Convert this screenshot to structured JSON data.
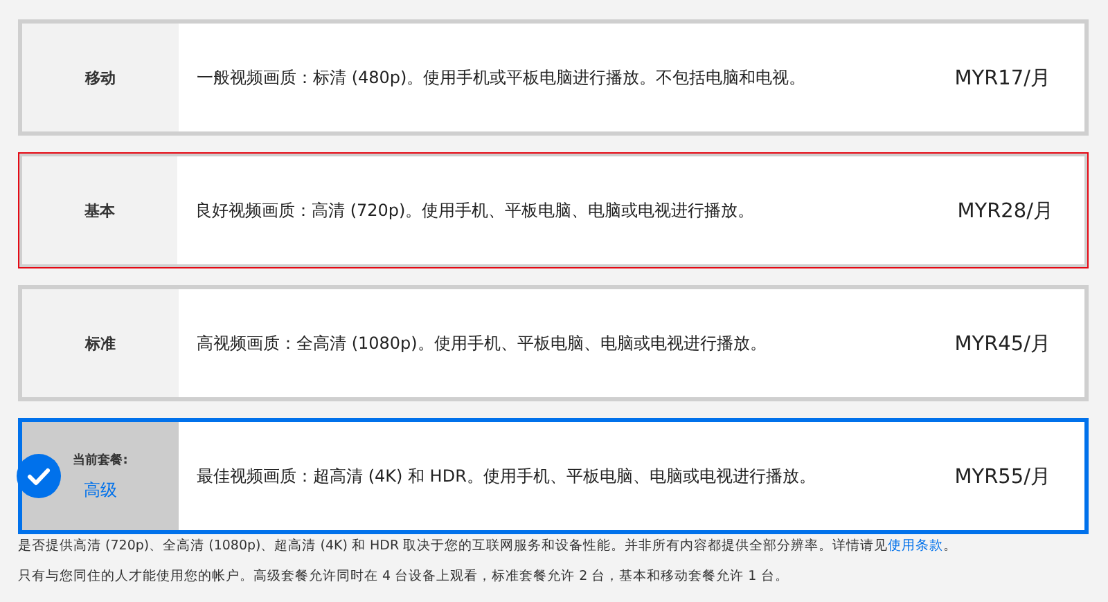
{
  "plans": [
    {
      "name": "移动",
      "description": "一般视频画质：标清 (480p)。使用手机或平板电脑进行播放。不包括电脑和电视。",
      "price": "MYR17/月",
      "selected": false,
      "focused": false
    },
    {
      "name": "基本",
      "description": "良好视频画质：高清 (720p)。使用手机、平板电脑、电脑或电视进行播放。",
      "price": "MYR28/月",
      "selected": false,
      "focused": true
    },
    {
      "name": "标准",
      "description": "高视频画质：全高清 (1080p)。使用手机、平板电脑、电脑或电视进行播放。",
      "price": "MYR45/月",
      "selected": false,
      "focused": false
    },
    {
      "current_label": "当前套餐:",
      "name": "高级",
      "description": "最佳视频画质：超高清 (4K) 和 HDR。使用手机、平板电脑、电脑或电视进行播放。",
      "price": "MYR55/月",
      "selected": true,
      "focused": false
    }
  ],
  "footnotes": [
    {
      "text": "是否提供高清 (720p)、全高清 (1080p)、超高清 (4K) 和 HDR 取决于您的互联网服务和设备性能。并非所有内容都提供全部分辨率。详情请见",
      "link": "使用条款",
      "text_after": "。"
    },
    {
      "text": "只有与您同住的人才能使用您的帐户。高级套餐允许同时在 4 台设备上观看，标准套餐允许 2 台，基本和移动套餐允许 1 台。"
    }
  ]
}
